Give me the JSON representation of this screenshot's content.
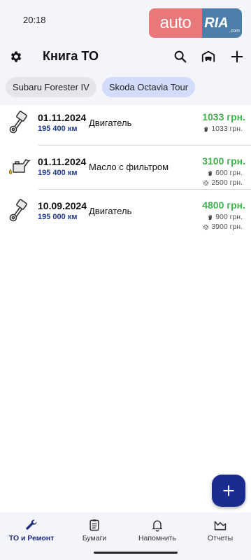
{
  "status_bar": {
    "time": "20:18"
  },
  "ad": {
    "left_text": "auto",
    "right_text": "RIA",
    "right_suffix": ".com"
  },
  "app_bar": {
    "title": "Книга ТО"
  },
  "cars": [
    {
      "label": "Subaru Forester IV",
      "selected": false
    },
    {
      "label": "Skoda Octavia Tour",
      "selected": true
    }
  ],
  "records": [
    {
      "date": "01.11.2024",
      "mileage": "195 400 км",
      "name": "Двигатель",
      "total": "1033 грн.",
      "labor": "1033 грн.",
      "parts": null,
      "icon": "engine-piston-icon"
    },
    {
      "date": "01.11.2024",
      "mileage": "195 400 км",
      "name": "Масло с фильтром",
      "total": "3100 грн.",
      "labor": "600 грн.",
      "parts": "2500 грн.",
      "icon": "oil-can-icon"
    },
    {
      "date": "10.09.2024",
      "mileage": "195 000 км",
      "name": "Двигатель",
      "total": "4800 грн.",
      "labor": "900 грн.",
      "parts": "3900 грн.",
      "icon": "engine-piston-icon"
    }
  ],
  "bottom_nav": [
    {
      "label": "ТО и Ремонт",
      "icon": "wrench-icon",
      "active": true
    },
    {
      "label": "Бумаги",
      "icon": "clipboard-icon",
      "active": false
    },
    {
      "label": "Напомнить",
      "icon": "bell-icon",
      "active": false
    },
    {
      "label": "Отчеты",
      "icon": "chart-icon",
      "active": false
    }
  ],
  "colors": {
    "accent": "#1a2d8f",
    "price": "#3fb44a",
    "mileage": "#203a8a",
    "chip_selected": "#d4dcfb"
  }
}
